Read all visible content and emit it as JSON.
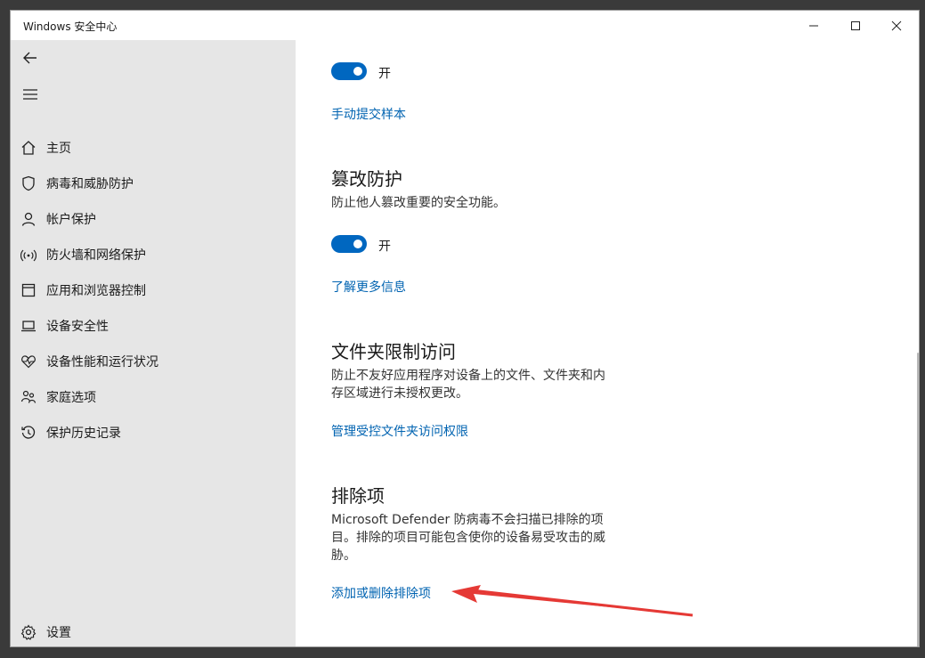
{
  "window": {
    "title": "Windows 安全中心"
  },
  "nav": {
    "items": [
      {
        "label": "主页",
        "icon": "home-icon"
      },
      {
        "label": "病毒和威胁防护",
        "icon": "shield-icon"
      },
      {
        "label": "帐户保护",
        "icon": "person-icon"
      },
      {
        "label": "防火墙和网络保护",
        "icon": "wifi-icon"
      },
      {
        "label": "应用和浏览器控制",
        "icon": "app-window-icon"
      },
      {
        "label": "设备安全性",
        "icon": "laptop-icon"
      },
      {
        "label": "设备性能和运行状况",
        "icon": "heart-pulse-icon"
      },
      {
        "label": "家庭选项",
        "icon": "family-icon"
      },
      {
        "label": "保护历史记录",
        "icon": "history-icon"
      }
    ],
    "settings": {
      "label": "设置",
      "icon": "gear-icon"
    }
  },
  "content": {
    "top_toggle": {
      "label": "开",
      "on": true
    },
    "manual_submit_link": "手动提交样本",
    "tamper": {
      "heading": "篡改防护",
      "desc": "防止他人篡改重要的安全功能。",
      "toggle_label": "开",
      "toggle_on": true,
      "link": "了解更多信息"
    },
    "folder": {
      "heading": "文件夹限制访问",
      "desc": "防止不友好应用程序对设备上的文件、文件夹和内存区域进行未授权更改。",
      "link": "管理受控文件夹访问权限"
    },
    "exclusions": {
      "heading": "排除项",
      "desc": "Microsoft Defender 防病毒不会扫描已排除的项目。排除的项目可能包含使你的设备易受攻击的威胁。",
      "link": "添加或删除排除项"
    }
  },
  "colors": {
    "accent": "#0067c0",
    "link": "#0063b1",
    "sidebar": "#e6e6e6",
    "annotation": "#e53935"
  }
}
